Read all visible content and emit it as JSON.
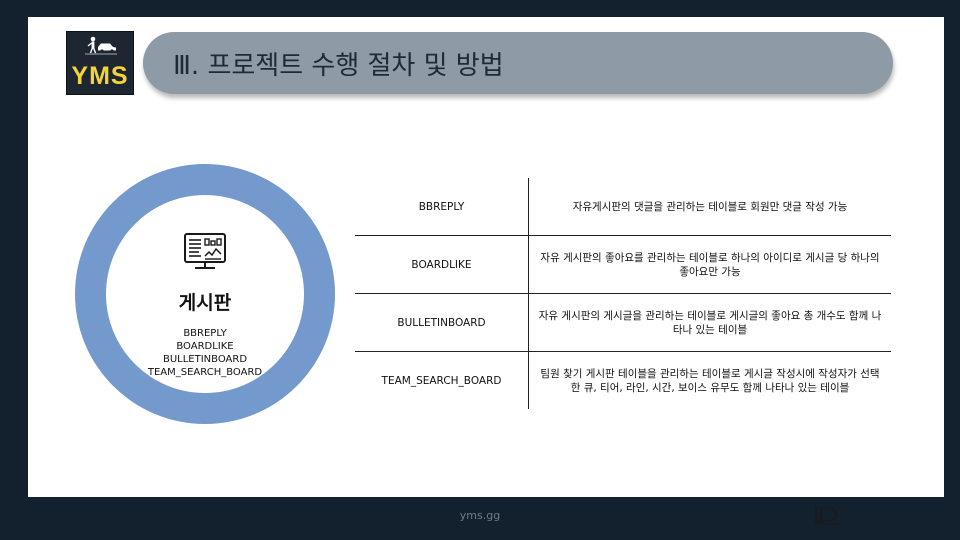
{
  "header": {
    "logo_text": "YMS",
    "title": "Ⅲ. 프로젝트 수행 절차 및 방법"
  },
  "center": {
    "icon": "bulletin-board-icon",
    "title": "게시판",
    "items": [
      "BBREPLY",
      "BOARDLIKE",
      "BULLETINBOARD",
      "TEAM_SEARCH_BOARD"
    ]
  },
  "table": {
    "rows": [
      {
        "name": "BBREPLY",
        "description": "자유게시판의 댓글을 관리하는 테이블로 회원만 댓글 작성 가능"
      },
      {
        "name": "BOARDLIKE",
        "description": "자유 게시판의 좋아요를 관리하는 테이블로 하나의 아이디로 게시글 당 하나의 좋아요만 가능"
      },
      {
        "name": "BULLETINBOARD",
        "description": "자유 게시판의 게시글을 관리하는 테이블로 게시글의 좋아요 총 개수도 함께 나타나 있는 테이블"
      },
      {
        "name": "TEAM_SEARCH_BOARD",
        "description": "팀원 찾기 게시판 테이블을 관리하는 테이블로 게시글 작성시에 작성자가 선택한 큐, 티어, 라인, 시간, 보이스 유무도 함께 나타나 있는 테이블"
      }
    ]
  },
  "footer": {
    "url": "yms.gg",
    "logo_icon": "league-logo-icon"
  },
  "colors": {
    "background": "#13202e",
    "title_bar": "#8e9aa5",
    "ring": "#7499cc",
    "logo_yellow": "#f3d23a"
  }
}
